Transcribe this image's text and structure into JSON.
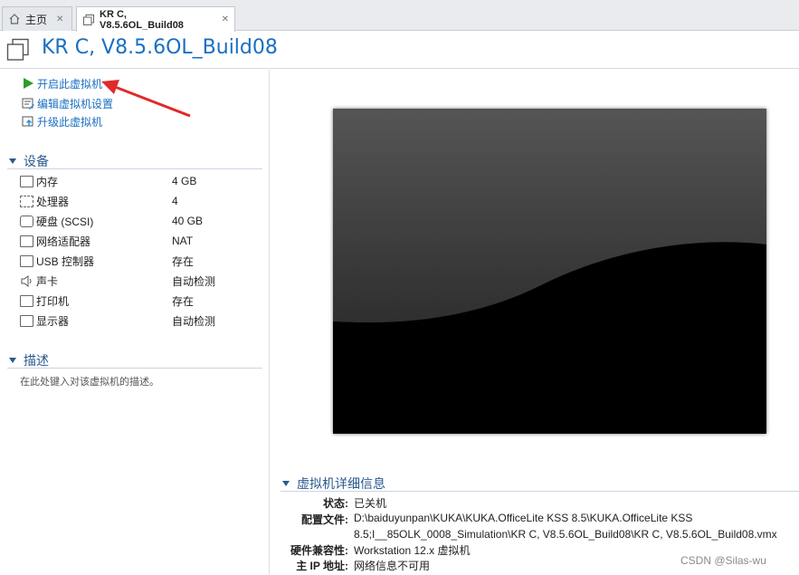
{
  "tabs": [
    {
      "label": "主页",
      "icon": "home-icon"
    },
    {
      "label": "KR C, V8.5.6OL_Build08",
      "icon": "vm-icon"
    }
  ],
  "tab_close": "✕",
  "header": {
    "title": "KR C, V8.5.6OL_Build08"
  },
  "actions": [
    {
      "label": "开启此虚拟机",
      "icon": "play-icon"
    },
    {
      "label": "编辑虚拟机设置",
      "icon": "edit-settings-icon"
    },
    {
      "label": "升级此虚拟机",
      "icon": "upgrade-icon"
    }
  ],
  "devices_section": {
    "title": "设备"
  },
  "devices": [
    {
      "name": "内存",
      "value": "4 GB",
      "icon": "memory-icon"
    },
    {
      "name": "处理器",
      "value": "4",
      "icon": "cpu-icon"
    },
    {
      "name": "硬盘 (SCSI)",
      "value": "40 GB",
      "icon": "harddisk-icon"
    },
    {
      "name": "网络适配器",
      "value": "NAT",
      "icon": "network-icon"
    },
    {
      "name": "USB 控制器",
      "value": "存在",
      "icon": "usb-icon"
    },
    {
      "name": "声卡",
      "value": "自动检测",
      "icon": "sound-icon"
    },
    {
      "name": "打印机",
      "value": "存在",
      "icon": "printer-icon"
    },
    {
      "name": "显示器",
      "value": "自动检测",
      "icon": "display-icon"
    }
  ],
  "description_section": {
    "title": "描述",
    "placeholder": "在此处键入对该虚拟机的描述。"
  },
  "details_section": {
    "title": "虚拟机详细信息",
    "rows": [
      {
        "label": "状态:",
        "value": "已关机"
      },
      {
        "label": "配置文件:",
        "value": "D:\\baiduyunpan\\KUKA\\KUKA.OfficeLite KSS 8.5\\KUKA.OfficeLite KSS"
      },
      {
        "label": "",
        "value": "8.5;I__85OLK_0008_Simulation\\KR C, V8.5.6OL_Build08\\KR C, V8.5.6OL_Build08.vmx"
      },
      {
        "label": "硬件兼容性:",
        "value": "Workstation 12.x 虚拟机"
      },
      {
        "label": "主 IP 地址:",
        "value": "网络信息不可用"
      }
    ]
  },
  "watermark": "CSDN @Silas-wu",
  "colors": {
    "accent": "#1a6fc2",
    "play": "#2e9b2e",
    "annotation_arrow": "#e02a2a"
  }
}
